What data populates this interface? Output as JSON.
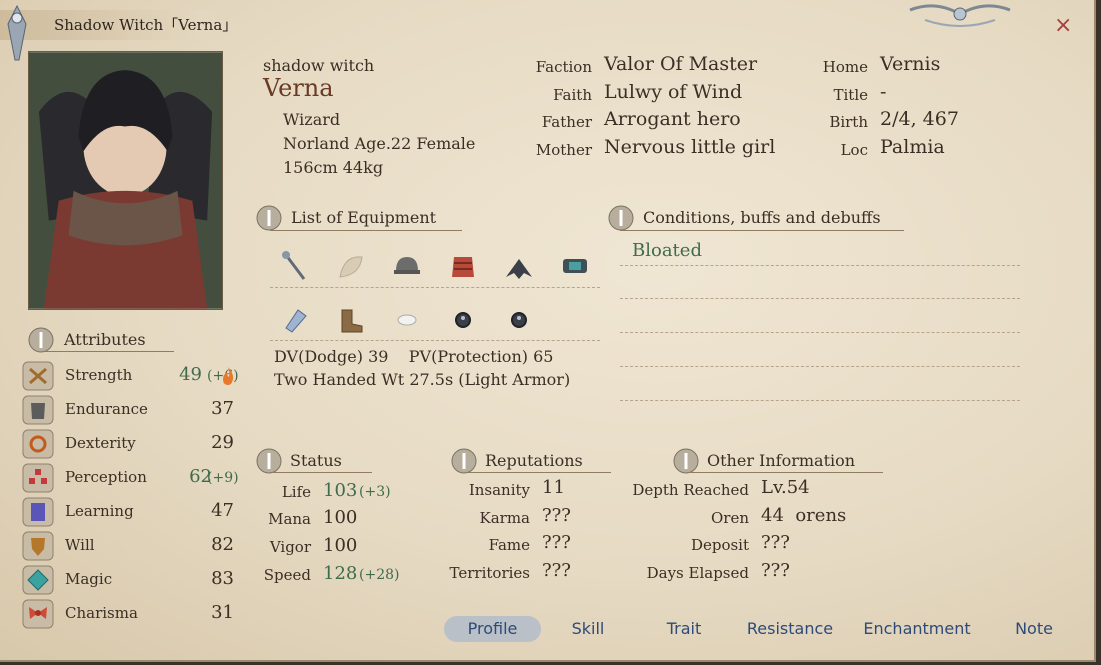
{
  "window": {
    "title": "Shadow Witch「Verna」",
    "close_label": "×"
  },
  "profile": {
    "role": "shadow witch",
    "name": "Verna",
    "class": "Wizard",
    "origin_line": "Norland Age.22 Female",
    "body_line": "156cm 44kg"
  },
  "info": {
    "faction_label": "Faction",
    "faction": "Valor Of Master",
    "faith_label": "Faith",
    "faith": "Lulwy of Wind",
    "father_label": "Father",
    "father": "Arrogant hero",
    "mother_label": "Mother",
    "mother": "Nervous little girl",
    "home_label": "Home",
    "home": "Vernis",
    "title_label": "Title",
    "title": "-",
    "birth_label": "Birth",
    "birth": "2/4, 467",
    "loc_label": "Loc",
    "loc": "Palmia"
  },
  "equipment": {
    "header": "List of Equipment",
    "row1_icons": [
      "staff-icon",
      "cloak-icon",
      "helmet-icon",
      "armor-icon",
      "wings-icon",
      "belt-icon"
    ],
    "row2_icons": [
      "gauntlet-icon",
      "boots-icon",
      "amulet-icon",
      "ring-icon",
      "ring-icon"
    ],
    "dv_line": "DV(Dodge) 39    PV(Protection) 65",
    "wt_line": "Two Handed Wt 27.5s (Light Armor)"
  },
  "conditions": {
    "header": "Conditions, buffs and debuffs",
    "items": [
      "Bloated"
    ]
  },
  "attributes": {
    "header": "Attributes",
    "items": [
      {
        "label": "Strength",
        "value": "49",
        "bonus": "(+6)",
        "icon": "strength-icon"
      },
      {
        "label": "Endurance",
        "value": "37",
        "bonus": "",
        "icon": "endurance-icon"
      },
      {
        "label": "Dexterity",
        "value": "29",
        "bonus": "",
        "icon": "dexterity-icon"
      },
      {
        "label": "Perception",
        "value": "62",
        "bonus": "(+9)",
        "icon": "perception-icon"
      },
      {
        "label": "Learning",
        "value": "47",
        "bonus": "",
        "icon": "learning-icon"
      },
      {
        "label": "Will",
        "value": "82",
        "bonus": "",
        "icon": "will-icon"
      },
      {
        "label": "Magic",
        "value": "83",
        "bonus": "",
        "icon": "magic-icon"
      },
      {
        "label": "Charisma",
        "value": "31",
        "bonus": "",
        "icon": "charisma-icon"
      }
    ]
  },
  "status": {
    "header": "Status",
    "life_label": "Life",
    "life": "103",
    "life_bonus": "(+3)",
    "mana_label": "Mana",
    "mana": "100",
    "vigor_label": "Vigor",
    "vigor": "100",
    "speed_label": "Speed",
    "speed": "128",
    "speed_bonus": "(+28)"
  },
  "reputations": {
    "header": "Reputations",
    "insanity_label": "Insanity",
    "insanity": "11",
    "karma_label": "Karma",
    "karma": "???",
    "fame_label": "Fame",
    "fame": "???",
    "territories_label": "Territories",
    "territories": "???"
  },
  "other": {
    "header": "Other Information",
    "depth_label": "Depth Reached",
    "depth": "Lv.54",
    "oren_label": "Oren",
    "oren": "44  orens",
    "deposit_label": "Deposit",
    "deposit": "???",
    "days_label": "Days Elapsed",
    "days": "???"
  },
  "tabs": [
    "Profile",
    "Skill",
    "Trait",
    "Resistance",
    "Enchantment",
    "Note"
  ],
  "colors": {
    "accent_name": "#6a3a24",
    "bonus_green": "#3f6b4b",
    "tab_blue": "#2e4a78"
  }
}
